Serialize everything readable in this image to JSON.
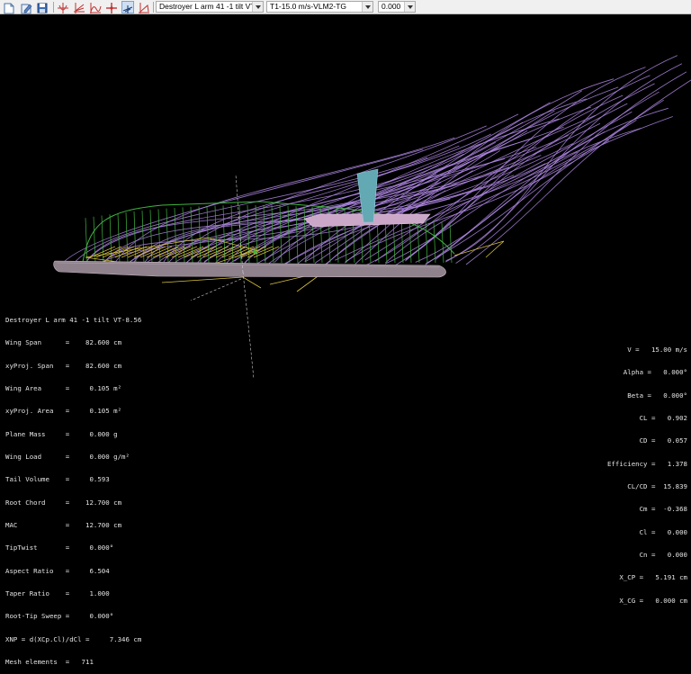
{
  "toolbar": {
    "icons": [
      "open-file-icon",
      "edit-icon",
      "save-icon",
      "polar-view-icon",
      "opp-view-icon",
      "graph-view-icon",
      "cross-hair-icon",
      "plane-3d-view-icon",
      "wing-3d-view-icon"
    ],
    "plane_select": "Destroyer L arm 41 -1 tilt VT-8.56",
    "polar_select": "T1-15.0 m/s-VLM2-TG",
    "opp_select": "0.000"
  },
  "colors": {
    "streamline": "#b18ae8",
    "cp_green": "#3fb53f",
    "gradient_yellow": "#d8c23c",
    "wing": "#8f828c",
    "fin": "#62a9b4",
    "tail": "#cba7c8"
  },
  "plane_info": {
    "title": "Destroyer L arm 41 -1 tilt VT-8.56",
    "lines": [
      "Wing Span      =    82.600 cm",
      "xyProj. Span   =    82.600 cm",
      "Wing Area      =     0.105 m²",
      "xyProj. Area   =     0.105 m²",
      "Plane Mass     =     0.000 g",
      "Wing Load      =     0.000 g/m²",
      "Tail Volume    =     0.593",
      "Root Chord     =    12.700 cm",
      "MAC            =    12.700 cm",
      "TipTwist       =     0.000°",
      "Aspect Ratio   =     6.504",
      "Taper Ratio    =     1.000",
      "Root-Tip Sweep =     0.000°",
      "XNP = d(XCp.Cl)/dCl =     7.346 cm",
      "Mesh elements  =   711"
    ]
  },
  "aero_results": [
    "V =   15.00 m/s",
    "Alpha =   0.000°",
    "Beta =   0.000°",
    "CL =   0.902",
    "CD =   0.057",
    "Efficiency =   1.378",
    "CL/CD =  15.839",
    "Cm =  -0.368",
    "Cl =   0.000",
    "Cn =   0.000",
    "X_CP =   5.191 cm",
    "X_CG =   0.000 cm"
  ]
}
